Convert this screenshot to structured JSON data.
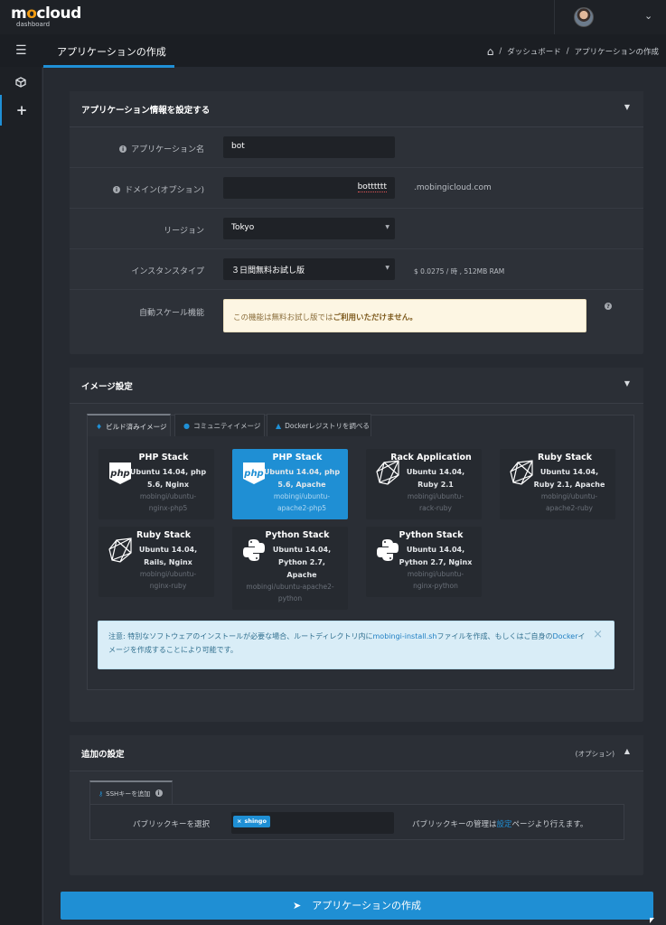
{
  "header": {
    "logo_text": "m",
    "logo_o": "o",
    "logo_rest": "cloud",
    "logo_sub": "dashboard",
    "user_caret": "⌄"
  },
  "subbar": {
    "title": "アプリケーションの作成",
    "breadcrumb": [
      "ダッシュボード",
      "アプリケーションの作成"
    ],
    "separator": "/"
  },
  "app_info": {
    "title": "アプリケーション情報を設定する",
    "fields": {
      "app_name_label": "アプリケーション名",
      "app_name_value": "bot",
      "domain_label": "ドメイン(オプション)",
      "domain_value": "botttttt",
      "domain_suffix": ".mobingicloud.com",
      "region_label": "リージョン",
      "region_value": "Tokyo",
      "instance_label": "インスタンスタイプ",
      "instance_value": "３日間無料お試し版",
      "instance_price": "$ 0.0275 / 時 , 512MB RAM",
      "autoscale_label": "自動スケール機能",
      "autoscale_warn_prefix": "この機能は無料お試し版では",
      "autoscale_warn_bold": "ご利用いただけません。"
    }
  },
  "image_settings": {
    "title": "イメージ設定",
    "tabs": [
      "ビルド済みイメージ",
      "コミュニティイメージ",
      "Dockerレジストリを調べる"
    ],
    "cards": [
      {
        "name": "PHP Stack",
        "desc": [
          "Ubuntu 14.04, php",
          "5.6, Nginx"
        ],
        "image": [
          "mobingi/ubuntu-",
          "nginx-php5"
        ],
        "icon": "php-icon"
      },
      {
        "name": "PHP Stack",
        "desc": [
          "Ubuntu 14.04, php",
          "5.6, Apache"
        ],
        "image": [
          "mobingi/ubuntu-",
          "apache2-php5"
        ],
        "icon": "php-icon"
      },
      {
        "name": "Rack Application",
        "desc": [
          "Ubuntu 14.04,",
          "Ruby 2.1"
        ],
        "image": [
          "mobingi/ubuntu-",
          "rack-ruby"
        ],
        "icon": "ruby-icon"
      },
      {
        "name": "Ruby Stack",
        "desc": [
          "Ubuntu 14.04,",
          "Ruby 2.1, Apache"
        ],
        "image": [
          "mobingi/ubuntu-",
          "apache2-ruby"
        ],
        "icon": "ruby-icon"
      },
      {
        "name": "Ruby Stack",
        "desc": [
          "Ubuntu 14.04,",
          "Rails, Nginx"
        ],
        "image": [
          "mobingi/ubuntu-",
          "nginx-ruby"
        ],
        "icon": "ruby-icon"
      },
      {
        "name": "Python Stack",
        "desc": [
          "Ubuntu 14.04,",
          "Python 2.7,",
          "Apache"
        ],
        "image": [
          "mobingi/ubuntu-apache2-",
          "python"
        ],
        "icon": "python-icon"
      },
      {
        "name": "Python Stack",
        "desc": [
          "Ubuntu 14.04,",
          "Python 2.7, Nginx"
        ],
        "image": [
          "mobingi/ubuntu-",
          "nginx-python"
        ],
        "icon": "python-icon"
      }
    ],
    "note": {
      "p1": "注意: 特別なソフトウェアのインストールが必要な場合、ルートディレクトリ内に",
      "link1": "mobingi-install.sh",
      "p2": "ファイルを作成、もしくはご自身の",
      "link2": "Docker",
      "p3": "イメージを作成することにより可能です。",
      "close": "×"
    }
  },
  "additional": {
    "title": "追加の設定",
    "optional": "(オプション)",
    "tab": "SSHキーを追加",
    "pk_label": "パブリックキーを選択",
    "pk_tag": "shingo",
    "pk_tag_x": "×",
    "hint_prefix": "パブリックキーの管理は",
    "hint_link": "設定",
    "hint_suffix": "ページより行えます。"
  },
  "submit_label": "アプリケーションの作成",
  "colors": {
    "accent": "#1f8fd4",
    "logo_o": "#f39c12",
    "warn_bg": "#fdf6e3",
    "note_bg": "#d9edf7"
  }
}
